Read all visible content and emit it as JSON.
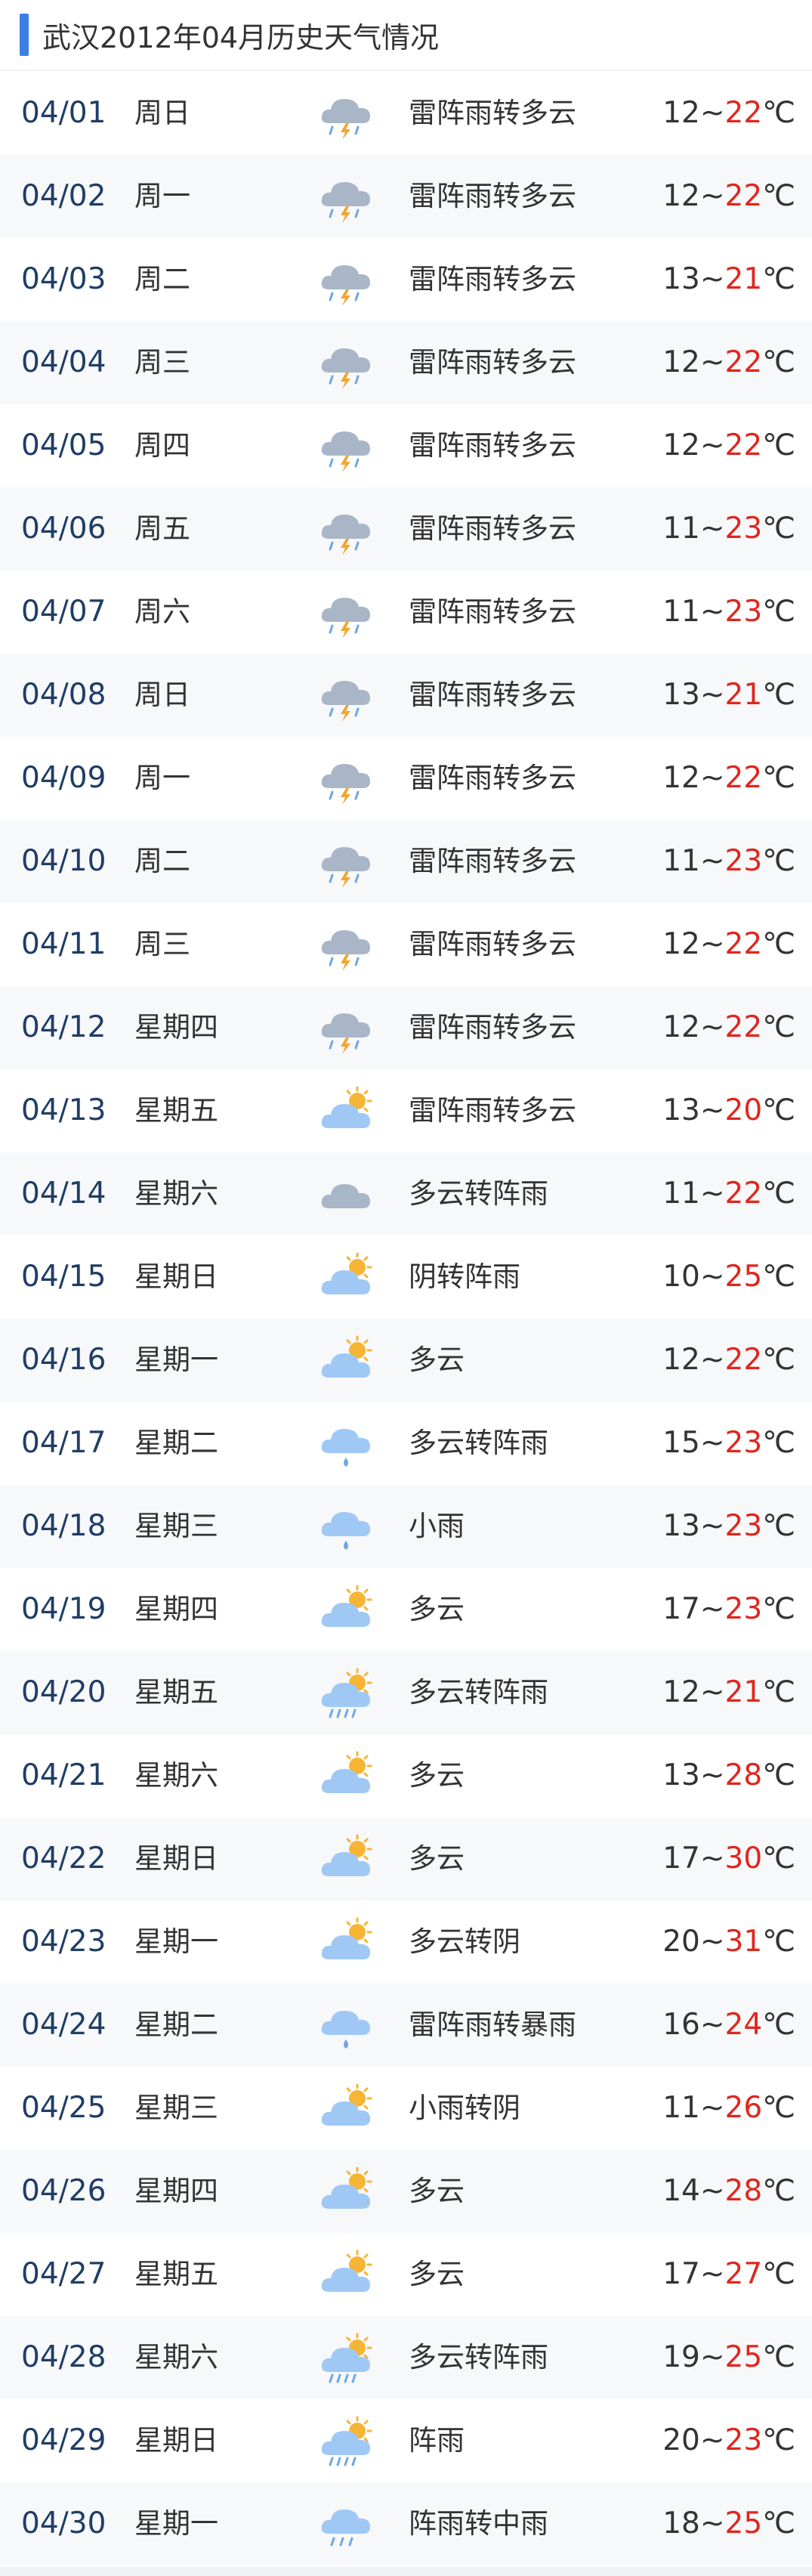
{
  "header": {
    "title": "武汉2012年04月历史天气情况",
    "accent_color": "#3d7fe0"
  },
  "colors": {
    "date": "#1f3d66",
    "high_temp": "#e0261e",
    "row_alt_bg": "#f7f8fa"
  },
  "temp_separator": "~",
  "temp_unit": "℃",
  "rows": [
    {
      "date": "04/01",
      "week": "周日",
      "icon": "thunder-rain-icon",
      "condition": "雷阵雨转多云",
      "low": "12",
      "high": "22"
    },
    {
      "date": "04/02",
      "week": "周一",
      "icon": "thunder-rain-icon",
      "condition": "雷阵雨转多云",
      "low": "12",
      "high": "22"
    },
    {
      "date": "04/03",
      "week": "周二",
      "icon": "thunder-rain-icon",
      "condition": "雷阵雨转多云",
      "low": "13",
      "high": "21"
    },
    {
      "date": "04/04",
      "week": "周三",
      "icon": "thunder-rain-icon",
      "condition": "雷阵雨转多云",
      "low": "12",
      "high": "22"
    },
    {
      "date": "04/05",
      "week": "周四",
      "icon": "thunder-rain-icon",
      "condition": "雷阵雨转多云",
      "low": "12",
      "high": "22"
    },
    {
      "date": "04/06",
      "week": "周五",
      "icon": "thunder-rain-icon",
      "condition": "雷阵雨转多云",
      "low": "11",
      "high": "23"
    },
    {
      "date": "04/07",
      "week": "周六",
      "icon": "thunder-rain-icon",
      "condition": "雷阵雨转多云",
      "low": "11",
      "high": "23"
    },
    {
      "date": "04/08",
      "week": "周日",
      "icon": "thunder-rain-icon",
      "condition": "雷阵雨转多云",
      "low": "13",
      "high": "21"
    },
    {
      "date": "04/09",
      "week": "周一",
      "icon": "thunder-rain-icon",
      "condition": "雷阵雨转多云",
      "low": "12",
      "high": "22"
    },
    {
      "date": "04/10",
      "week": "周二",
      "icon": "thunder-rain-icon",
      "condition": "雷阵雨转多云",
      "low": "11",
      "high": "23"
    },
    {
      "date": "04/11",
      "week": "周三",
      "icon": "thunder-rain-icon",
      "condition": "雷阵雨转多云",
      "low": "12",
      "high": "22"
    },
    {
      "date": "04/12",
      "week": "星期四",
      "icon": "thunder-rain-icon",
      "condition": "雷阵雨转多云",
      "low": "12",
      "high": "22"
    },
    {
      "date": "04/13",
      "week": "星期五",
      "icon": "partly-cloudy-icon",
      "condition": "雷阵雨转多云",
      "low": "13",
      "high": "20"
    },
    {
      "date": "04/14",
      "week": "星期六",
      "icon": "overcast-icon",
      "condition": "多云转阵雨",
      "low": "11",
      "high": "22"
    },
    {
      "date": "04/15",
      "week": "星期日",
      "icon": "partly-cloudy-icon",
      "condition": "阴转阵雨",
      "low": "10",
      "high": "25"
    },
    {
      "date": "04/16",
      "week": "星期一",
      "icon": "partly-cloudy-icon",
      "condition": "多云",
      "low": "12",
      "high": "22"
    },
    {
      "date": "04/17",
      "week": "星期二",
      "icon": "light-rain-icon",
      "condition": "多云转阵雨",
      "low": "15",
      "high": "23"
    },
    {
      "date": "04/18",
      "week": "星期三",
      "icon": "light-rain-icon",
      "condition": "小雨",
      "low": "13",
      "high": "23"
    },
    {
      "date": "04/19",
      "week": "星期四",
      "icon": "partly-cloudy-icon",
      "condition": "多云",
      "low": "17",
      "high": "23"
    },
    {
      "date": "04/20",
      "week": "星期五",
      "icon": "sun-shower-icon",
      "condition": "多云转阵雨",
      "low": "12",
      "high": "21"
    },
    {
      "date": "04/21",
      "week": "星期六",
      "icon": "partly-cloudy-icon",
      "condition": "多云",
      "low": "13",
      "high": "28"
    },
    {
      "date": "04/22",
      "week": "星期日",
      "icon": "partly-cloudy-icon",
      "condition": "多云",
      "low": "17",
      "high": "30"
    },
    {
      "date": "04/23",
      "week": "星期一",
      "icon": "partly-cloudy-icon",
      "condition": "多云转阴",
      "low": "20",
      "high": "31"
    },
    {
      "date": "04/24",
      "week": "星期二",
      "icon": "light-rain-icon",
      "condition": "雷阵雨转暴雨",
      "low": "16",
      "high": "24"
    },
    {
      "date": "04/25",
      "week": "星期三",
      "icon": "partly-cloudy-icon",
      "condition": "小雨转阴",
      "low": "11",
      "high": "26"
    },
    {
      "date": "04/26",
      "week": "星期四",
      "icon": "partly-cloudy-icon",
      "condition": "多云",
      "low": "14",
      "high": "28"
    },
    {
      "date": "04/27",
      "week": "星期五",
      "icon": "partly-cloudy-icon",
      "condition": "多云",
      "low": "17",
      "high": "27"
    },
    {
      "date": "04/28",
      "week": "星期六",
      "icon": "sun-shower-icon",
      "condition": "多云转阵雨",
      "low": "19",
      "high": "25"
    },
    {
      "date": "04/29",
      "week": "星期日",
      "icon": "sun-shower-icon",
      "condition": "阵雨",
      "low": "20",
      "high": "23"
    },
    {
      "date": "04/30",
      "week": "星期一",
      "icon": "shower-icon",
      "condition": "阵雨转中雨",
      "low": "18",
      "high": "25"
    }
  ]
}
